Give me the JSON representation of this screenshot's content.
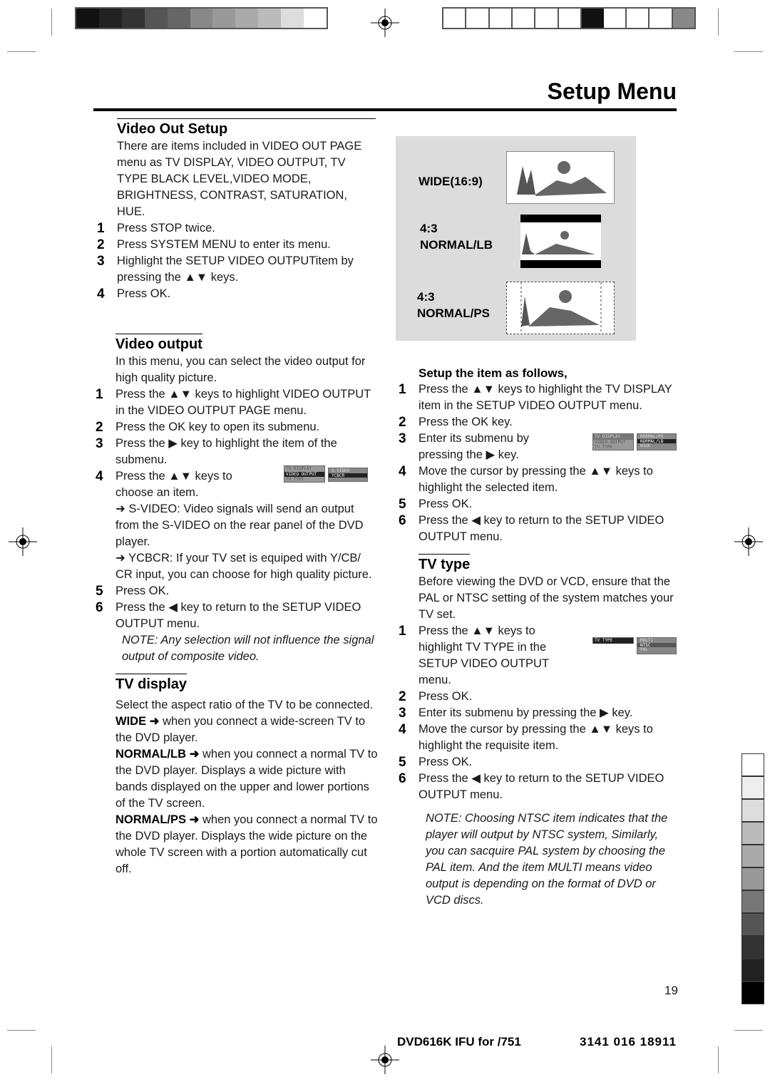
{
  "header": {
    "title": "Setup Menu"
  },
  "video_out_setup": {
    "title": "Video Out Setup",
    "intro": "There are items included in VIDEO OUT PAGE menu as TV DISPLAY, VIDEO OUTPUT, TV TYPE BLACK LEVEL,VIDEO MODE, BRIGHTNESS, CONTRAST, SATURATION, HUE.",
    "steps": [
      {
        "num": "1",
        "text": "Press STOP twice."
      },
      {
        "num": "2",
        "text": "Press SYSTEM MENU to enter its menu."
      },
      {
        "num": "3",
        "text": "Highlight the SETUP VIDEO OUTPUTitem by pressing the ▲▼ keys."
      },
      {
        "num": "4",
        "text": "Press OK."
      }
    ]
  },
  "video_output": {
    "title": "Video output",
    "intro": "In this menu, you can select the video output for high quality picture.",
    "steps": [
      {
        "num": "1",
        "text": "Press the ▲▼ keys to highlight VIDEO OUTPUT in the VIDEO OUTPUT PAGE menu."
      },
      {
        "num": "2",
        "text": "Press the OK key to open its submenu."
      },
      {
        "num": "3",
        "text": "Press the ▶ key to highlight the item of the submenu."
      },
      {
        "num": "4",
        "text": "Press the ▲▼ keys to choose an item."
      }
    ],
    "svideo": "➜ S-VIDEO: Video signals will send an output from the S-VIDEO on the rear panel of the DVD player.",
    "ycbcr": "➜ YCBCR: If your TV set is equiped with Y/CB/ CR input, you can choose for high quality picture.",
    "steps2": [
      {
        "num": "5",
        "text": "Press OK."
      },
      {
        "num": "6",
        "text": "Press the ◀ key to return to the SETUP VIDEO OUTPUT menu."
      }
    ],
    "note": "NOTE: Any selection will not influence the signal output of composite video.",
    "menu": {
      "left": [
        "TV DISPLAY",
        "VIDEO OUTPUT",
        "TV TYPE"
      ],
      "right": [
        "S-VIDEO",
        "YCBCR"
      ]
    }
  },
  "tv_display": {
    "title": "TV display",
    "intro": "Select the aspect ratio of the TV to be connected.",
    "wide_label": "WIDE ➜",
    "wide_text": " when you connect a wide-screen TV to the DVD player.",
    "lb_label": "NORMAL/LB ➜",
    "lb_text": " when you connect a normal TV to the DVD player. Displays a wide picture with bands displayed on the upper and lower portions of the TV screen.",
    "ps_label": "NORMAL/PS ➜",
    "ps_text": " when you connect a normal TV to the DVD player. Displays the wide picture on the whole TV screen with a portion automatically cut off."
  },
  "panel": {
    "wide": "WIDE(16:9)",
    "lb_ratio": "4:3",
    "lb": "NORMAL/LB",
    "ps_ratio": "4:3",
    "ps": "NORMAL/PS"
  },
  "setup_item": {
    "title": "Setup the item as follows,",
    "steps": [
      {
        "num": "1",
        "text": "Press the ▲▼ keys to highlight the TV DISPLAY item in the SETUP VIDEO OUTPUT menu."
      },
      {
        "num": "2",
        "text": "Press the OK key."
      },
      {
        "num": "3",
        "text": "Enter its submenu by pressing the ▶ key."
      },
      {
        "num": "4",
        "text": "Move the cursor by pressing the ▲▼ keys to highlight the selected item."
      },
      {
        "num": "5",
        "text": "Press OK."
      },
      {
        "num": "6",
        "text": "Press the ◀ key to return to the SETUP  VIDEO OUTPUT menu."
      }
    ],
    "menu": {
      "left": [
        "TV DISPLAY",
        "VIDEO OUTPUT",
        "TV TYPE"
      ],
      "right": [
        "NORMAL/PS",
        "NORMAL/LB",
        "WIDE"
      ]
    }
  },
  "tv_type": {
    "title": "TV type",
    "intro": "Before viewing the DVD or VCD, ensure that the PAL or NTSC setting of the system matches your TV set.",
    "steps": [
      {
        "num": "1",
        "text": "Press the ▲▼ keys to highlight TV TYPE in the SETUP VIDEO OUTPUT menu."
      },
      {
        "num": "2",
        "text": "Press OK."
      },
      {
        "num": "3",
        "text": "Enter its submenu by pressing the ▶ key."
      },
      {
        "num": "4",
        "text": "Move the cursor by pressing the ▲▼ keys to highlight the requisite item."
      },
      {
        "num": "5",
        "text": "Press OK."
      },
      {
        "num": "6",
        "text": "Press the ◀ key to return to the SETUP VIDEO OUTPUT menu."
      }
    ],
    "note": "NOTE: Choosing NTSC item indicates that the player will output by NTSC system, Similarly, you can sacquire PAL system by choosing the PAL item. And the item MULTI means video output is depending on the format of DVD or VCD discs.",
    "menu": {
      "left": [
        "TV TYPE"
      ],
      "right": [
        "MULTI",
        "NTSC",
        "PAL"
      ]
    }
  },
  "footer": {
    "page": "19",
    "doc": "DVD616K IFU for /751",
    "code": "3141 016 18911"
  }
}
